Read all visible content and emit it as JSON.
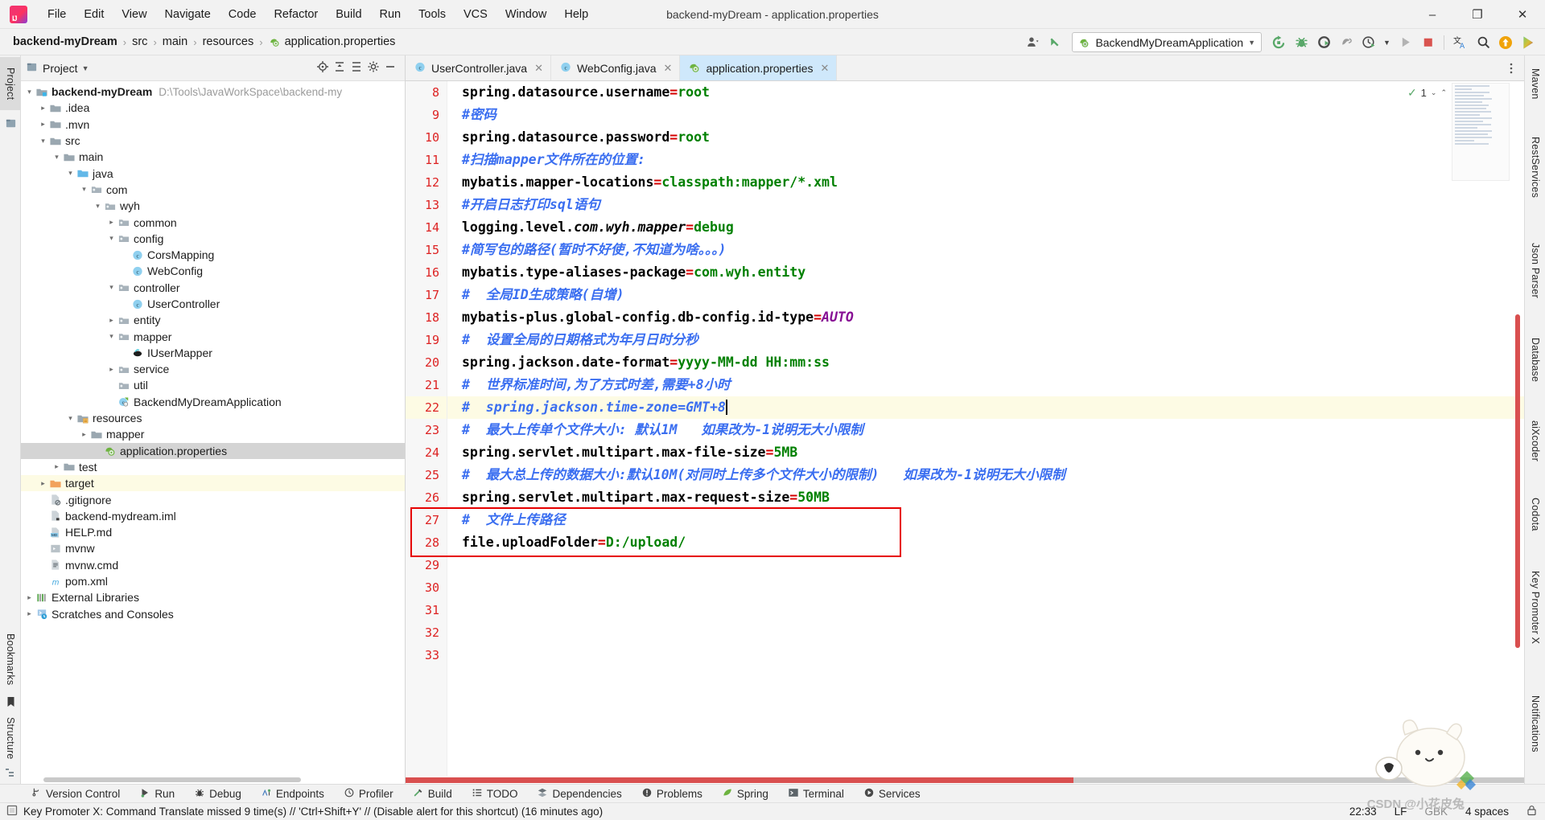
{
  "window": {
    "title": "backend-myDream - application.properties",
    "minimize": "–",
    "maximize": "❐",
    "close": "✕"
  },
  "menubar": {
    "items": [
      "File",
      "Edit",
      "View",
      "Navigate",
      "Code",
      "Refactor",
      "Build",
      "Run",
      "Tools",
      "VCS",
      "Window",
      "Help"
    ]
  },
  "breadcrumb": {
    "items": [
      "backend-myDream",
      "src",
      "main",
      "resources",
      "application.properties"
    ],
    "separator": "›"
  },
  "toolbar": {
    "run_config": "BackendMyDreamApplication",
    "dropdown_caret": "▼",
    "icons": [
      "user-avatar-icon",
      "update-project-icon",
      "rerun-icon",
      "debug-icon",
      "coverage-icon",
      "profiler-icon",
      "run-with-icon",
      "run-icon",
      "stop-icon",
      "translate-icon",
      "search-everywhere-icon",
      "updates-icon",
      "plugin-icon"
    ]
  },
  "left_strip": {
    "tabs": [
      "Project",
      "Bookmarks",
      "Structure"
    ]
  },
  "right_strip": {
    "tabs": [
      "Maven",
      "RestServices",
      "Json Parser",
      "Database",
      "aiXcoder",
      "Codota",
      "Key Promoter X",
      "Notifications"
    ]
  },
  "project_panel": {
    "title": "Project",
    "title_caret": "▼",
    "actions": [
      "locate-icon",
      "collapse-all-icon",
      "expand-all-icon",
      "settings-gear-icon",
      "hide-icon"
    ],
    "tree": [
      {
        "label": "backend-myDream",
        "path": "D:\\Tools\\JavaWorkSpace\\backend-my",
        "depth": 0,
        "arrow": "⌄",
        "icon": "module-folder-icon",
        "bold": true
      },
      {
        "label": ".idea",
        "path": "",
        "depth": 1,
        "arrow": "›",
        "icon": "folder-icon"
      },
      {
        "label": ".mvn",
        "path": "",
        "depth": 1,
        "arrow": "›",
        "icon": "folder-icon"
      },
      {
        "label": "src",
        "path": "",
        "depth": 1,
        "arrow": "⌄",
        "icon": "folder-icon"
      },
      {
        "label": "main",
        "path": "",
        "depth": 2,
        "arrow": "⌄",
        "icon": "folder-icon"
      },
      {
        "label": "java",
        "path": "",
        "depth": 3,
        "arrow": "⌄",
        "icon": "source-folder-icon"
      },
      {
        "label": "com",
        "path": "",
        "depth": 4,
        "arrow": "⌄",
        "icon": "package-icon"
      },
      {
        "label": "wyh",
        "path": "",
        "depth": 5,
        "arrow": "⌄",
        "icon": "package-icon"
      },
      {
        "label": "common",
        "path": "",
        "depth": 6,
        "arrow": "›",
        "icon": "package-icon"
      },
      {
        "label": "config",
        "path": "",
        "depth": 6,
        "arrow": "⌄",
        "icon": "package-icon"
      },
      {
        "label": "CorsMapping",
        "path": "",
        "depth": 7,
        "arrow": "",
        "icon": "java-class-icon"
      },
      {
        "label": "WebConfig",
        "path": "",
        "depth": 7,
        "arrow": "",
        "icon": "java-class-icon"
      },
      {
        "label": "controller",
        "path": "",
        "depth": 6,
        "arrow": "⌄",
        "icon": "package-icon"
      },
      {
        "label": "UserController",
        "path": "",
        "depth": 7,
        "arrow": "",
        "icon": "java-class-icon"
      },
      {
        "label": "entity",
        "path": "",
        "depth": 6,
        "arrow": "›",
        "icon": "package-icon"
      },
      {
        "label": "mapper",
        "path": "",
        "depth": 6,
        "arrow": "⌄",
        "icon": "package-icon"
      },
      {
        "label": "IUserMapper",
        "path": "",
        "depth": 7,
        "arrow": "",
        "icon": "mybatis-mapper-icon"
      },
      {
        "label": "service",
        "path": "",
        "depth": 6,
        "arrow": "›",
        "icon": "package-icon"
      },
      {
        "label": "util",
        "path": "",
        "depth": 6,
        "arrow": "",
        "icon": "package-icon"
      },
      {
        "label": "BackendMyDreamApplication",
        "path": "",
        "depth": 6,
        "arrow": "",
        "icon": "spring-boot-class-icon"
      },
      {
        "label": "resources",
        "path": "",
        "depth": 3,
        "arrow": "⌄",
        "icon": "resources-folder-icon"
      },
      {
        "label": "mapper",
        "path": "",
        "depth": 4,
        "arrow": "›",
        "icon": "folder-icon"
      },
      {
        "label": "application.properties",
        "path": "",
        "depth": 5,
        "arrow": "",
        "icon": "spring-properties-icon",
        "state": "selected"
      },
      {
        "label": "test",
        "path": "",
        "depth": 2,
        "arrow": "›",
        "icon": "folder-icon"
      },
      {
        "label": "target",
        "path": "",
        "depth": 1,
        "arrow": "›",
        "icon": "target-folder-icon",
        "state": "target"
      },
      {
        "label": ".gitignore",
        "path": "",
        "depth": 1,
        "arrow": "",
        "icon": "gitignore-file-icon"
      },
      {
        "label": "backend-mydream.iml",
        "path": "",
        "depth": 1,
        "arrow": "",
        "icon": "iml-file-icon"
      },
      {
        "label": "HELP.md",
        "path": "",
        "depth": 1,
        "arrow": "",
        "icon": "markdown-file-icon"
      },
      {
        "label": "mvnw",
        "path": "",
        "depth": 1,
        "arrow": "",
        "icon": "shell-file-icon"
      },
      {
        "label": "mvnw.cmd",
        "path": "",
        "depth": 1,
        "arrow": "",
        "icon": "cmd-file-icon"
      },
      {
        "label": "pom.xml",
        "path": "",
        "depth": 1,
        "arrow": "",
        "icon": "maven-pom-icon"
      },
      {
        "label": "External Libraries",
        "path": "",
        "depth": 0,
        "arrow": "›",
        "icon": "libraries-icon"
      },
      {
        "label": "Scratches and Consoles",
        "path": "",
        "depth": 0,
        "arrow": "›",
        "icon": "scratches-icon"
      }
    ]
  },
  "editor": {
    "tabs": [
      {
        "label": "UserController.java",
        "icon": "java-class-icon",
        "active": false,
        "close": "✕"
      },
      {
        "label": "WebConfig.java",
        "icon": "java-class-icon",
        "active": false,
        "close": "✕"
      },
      {
        "label": "application.properties",
        "icon": "spring-properties-icon",
        "active": true,
        "close": "✕"
      }
    ],
    "inspection_count": "1",
    "inspection_ok": "✓",
    "first_line_number": 8,
    "current_line": 22,
    "lines": [
      {
        "n": 8,
        "parts": [
          {
            "t": "spring.datasource.username",
            "c": "k"
          },
          {
            "t": "=",
            "c": "eq"
          },
          {
            "t": "root",
            "c": "v"
          }
        ]
      },
      {
        "n": 9,
        "parts": [
          {
            "t": "#密码",
            "c": "cmt"
          }
        ]
      },
      {
        "n": 10,
        "parts": [
          {
            "t": "spring.datasource.password",
            "c": "k"
          },
          {
            "t": "=",
            "c": "eq"
          },
          {
            "t": "root",
            "c": "v"
          }
        ]
      },
      {
        "n": 11,
        "parts": [
          {
            "t": "#扫描mapper文件所在的位置:",
            "c": "cmt"
          }
        ]
      },
      {
        "n": 12,
        "parts": [
          {
            "t": "mybatis.mapper-locations",
            "c": "k"
          },
          {
            "t": "=",
            "c": "eq"
          },
          {
            "t": "classpath:mapper/*.xml",
            "c": "v"
          }
        ]
      },
      {
        "n": 13,
        "parts": [
          {
            "t": "#开启日志打印sql语句",
            "c": "cmt"
          }
        ]
      },
      {
        "n": 14,
        "parts": [
          {
            "t": "logging.level.",
            "c": "k"
          },
          {
            "t": "com.wyh.mapper",
            "c": "kit"
          },
          {
            "t": "=",
            "c": "eq"
          },
          {
            "t": "debug",
            "c": "v"
          }
        ]
      },
      {
        "n": 15,
        "parts": [
          {
            "t": "#简写包的路径(暂时不好使,不知道为啥。。。)",
            "c": "cmt"
          }
        ]
      },
      {
        "n": 16,
        "parts": [
          {
            "t": "mybatis.type-aliases-package",
            "c": "k"
          },
          {
            "t": "=",
            "c": "eq"
          },
          {
            "t": "com.wyh.entity",
            "c": "v"
          }
        ]
      },
      {
        "n": 17,
        "parts": [
          {
            "t": "#  全局ID生成策略(自增)",
            "c": "cmt"
          }
        ]
      },
      {
        "n": 18,
        "parts": [
          {
            "t": "mybatis-plus.global-config.db-config.id-type",
            "c": "k"
          },
          {
            "t": "=",
            "c": "eq"
          },
          {
            "t": "AUTO",
            "c": "vit"
          }
        ]
      },
      {
        "n": 19,
        "parts": [
          {
            "t": "#  设置全局的日期格式为年月日时分秒",
            "c": "cmt"
          }
        ]
      },
      {
        "n": 20,
        "parts": [
          {
            "t": "spring.jackson.date-format",
            "c": "k"
          },
          {
            "t": "=",
            "c": "eq"
          },
          {
            "t": "yyyy-MM-dd HH:mm:ss",
            "c": "v"
          }
        ]
      },
      {
        "n": 21,
        "parts": [
          {
            "t": "#  世界标准时间,为了方式时差,需要+8小时",
            "c": "cmt"
          }
        ]
      },
      {
        "n": 22,
        "parts": [
          {
            "t": "#  spring.jackson.time-zone=GMT+8",
            "c": "cmt"
          }
        ],
        "current": true,
        "caret": true
      },
      {
        "n": 23,
        "parts": [
          {
            "t": "#  最大上传单个文件大小: 默认1M   如果改为-1说明无大小限制",
            "c": "cmt"
          }
        ]
      },
      {
        "n": 24,
        "parts": [
          {
            "t": "spring.servlet.multipart.max-file-size",
            "c": "k"
          },
          {
            "t": "=",
            "c": "eq"
          },
          {
            "t": "5MB",
            "c": "v"
          }
        ]
      },
      {
        "n": 25,
        "parts": [
          {
            "t": "#  最大总上传的数据大小:默认10M(对同时上传多个文件大小的限制)   如果改为-1说明无大小限制",
            "c": "cmt"
          }
        ]
      },
      {
        "n": 26,
        "parts": [
          {
            "t": "spring.servlet.multipart.max-request-size",
            "c": "k"
          },
          {
            "t": "=",
            "c": "eq"
          },
          {
            "t": "50MB",
            "c": "v"
          }
        ]
      },
      {
        "n": 27,
        "parts": [
          {
            "t": "#  文件上传路径",
            "c": "cmt"
          }
        ]
      },
      {
        "n": 28,
        "parts": [
          {
            "t": "file.uploadFolder",
            "c": "k"
          },
          {
            "t": "=",
            "c": "eq"
          },
          {
            "t": "D:/upload/",
            "c": "v"
          }
        ]
      },
      {
        "n": 29,
        "parts": []
      },
      {
        "n": 30,
        "parts": []
      },
      {
        "n": 31,
        "parts": []
      },
      {
        "n": 32,
        "parts": []
      },
      {
        "n": 33,
        "parts": []
      }
    ],
    "highlight_box": {
      "color": "#e60000",
      "from_line": 27,
      "to_line": 28
    }
  },
  "tool_windows": {
    "items": [
      {
        "label": "Version Control",
        "icon": "branch-icon"
      },
      {
        "label": "Run",
        "icon": "run-icon"
      },
      {
        "label": "Debug",
        "icon": "debug-icon"
      },
      {
        "label": "Endpoints",
        "icon": "endpoints-icon"
      },
      {
        "label": "Profiler",
        "icon": "profiler-icon"
      },
      {
        "label": "Build",
        "icon": "build-hammer-icon"
      },
      {
        "label": "TODO",
        "icon": "todo-icon"
      },
      {
        "label": "Dependencies",
        "icon": "dependencies-icon"
      },
      {
        "label": "Problems",
        "icon": "problems-icon"
      },
      {
        "label": "Spring",
        "icon": "spring-leaf-icon"
      },
      {
        "label": "Terminal",
        "icon": "terminal-icon"
      },
      {
        "label": "Services",
        "icon": "services-icon"
      }
    ]
  },
  "statusbar": {
    "message": "Key Promoter X: Command Translate missed 9 time(s) // 'Ctrl+Shift+Y' // (Disable alert for this shortcut) (16 minutes ago)",
    "message_icon": "notification-icon",
    "caret_position": "22:33",
    "line_separator": "LF",
    "encoding": "GBK",
    "indent": "4 spaces",
    "lock_icon": "lock-icon"
  },
  "watermark": {
    "text": "CSDN @小花皮兔"
  },
  "colors": {
    "accent_blue": "#3a6ef0",
    "value_green": "#008000",
    "equals_red": "#d40000",
    "line_number_red": "#dd2222",
    "active_tab_blue": "#cfe8fb",
    "current_line_yellow": "#fdfbe4",
    "highlight_box_red": "#e60000"
  }
}
